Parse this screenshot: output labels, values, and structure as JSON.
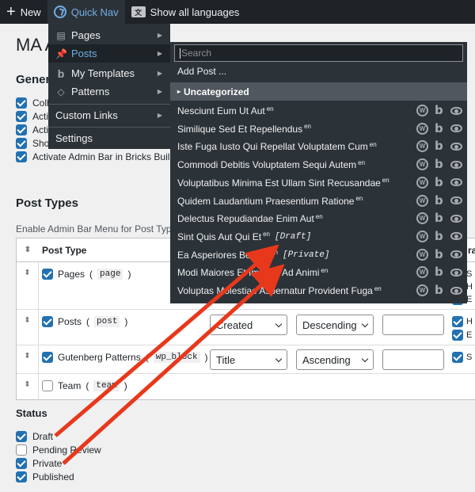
{
  "adminbar": {
    "new_label": "New",
    "quicknav_label": "Quick Nav",
    "languages_label": "Show all languages"
  },
  "quicknav_menu": {
    "items": [
      {
        "label": "Pages",
        "icon": "pages-icon"
      },
      {
        "label": "Posts",
        "icon": "pin-icon"
      },
      {
        "label": "My Templates",
        "icon": "bricks-icon"
      },
      {
        "label": "Patterns",
        "icon": "patterns-icon"
      },
      {
        "label": "Custom Links"
      },
      {
        "label": "Settings"
      }
    ]
  },
  "posts_submenu": {
    "search_placeholder": "Search",
    "add_post_label": "Add Post ...",
    "category_label": "Uncategorized",
    "posts": [
      {
        "title": "Nesciunt Eum Ut Aut",
        "lang": "en",
        "status": ""
      },
      {
        "title": "Similique Sed Et Repellendus",
        "lang": "en",
        "status": ""
      },
      {
        "title": "Iste Fuga Iusto Qui Repellat Voluptatem Cum",
        "lang": "en",
        "status": ""
      },
      {
        "title": "Commodi Debitis Voluptatem Sequi Autem",
        "lang": "en",
        "status": ""
      },
      {
        "title": "Voluptatibus Minima Est Ullam Sint Recusandae",
        "lang": "en",
        "status": ""
      },
      {
        "title": "Quidem Laudantium Praesentium Ratione",
        "lang": "en",
        "status": ""
      },
      {
        "title": "Delectus Repudiandae Enim Aut",
        "lang": "en",
        "status": ""
      },
      {
        "title": "Sint Quis Aut Qui Et",
        "lang": "en",
        "status": "[Draft]"
      },
      {
        "title": "Ea Asperiores Beatae",
        "lang": "en",
        "status": "[Private]"
      },
      {
        "title": "Modi Maiores Et Impedit Ad Animi",
        "lang": "en",
        "status": ""
      },
      {
        "title": "Voluptas Molestiae Aspernatur Provident Fuga",
        "lang": "en",
        "status": ""
      }
    ]
  },
  "page": {
    "title": "MA A",
    "general_heading": "Gener",
    "general_items": [
      {
        "label": "Coll",
        "checked": true
      },
      {
        "label": "Acti",
        "checked": true
      },
      {
        "label": "Acti",
        "checked": true
      },
      {
        "label": "Sho",
        "checked": true
      },
      {
        "label": "Activate Admin Bar in Bricks Buil",
        "checked": true
      }
    ],
    "post_types_heading": "Post Types",
    "post_types_subtext": "Enable Admin Bar Menu for Post Type",
    "table_header": "Post Type",
    "table_header_right": "ra",
    "rows": [
      {
        "label": "Pages",
        "slug": "page",
        "checked": true
      },
      {
        "label": "Posts",
        "slug": "post",
        "checked": true,
        "orderby": "Created",
        "order": "Descending",
        "mini": [
          "H",
          "E"
        ]
      },
      {
        "label": "Gutenberg Patterns",
        "slug": "wp_block",
        "checked": true,
        "orderby": "Title",
        "order": "Ascending",
        "mini": [
          "S"
        ]
      },
      {
        "label": "Team",
        "slug": "team",
        "checked": false
      }
    ],
    "pages_row_mini": [
      "S",
      "H",
      "E"
    ],
    "status_heading": "Status",
    "status_items": [
      {
        "label": "Draft",
        "checked": true
      },
      {
        "label": "Pending Review",
        "checked": false
      },
      {
        "label": "Private",
        "checked": true
      },
      {
        "label": "Published",
        "checked": true
      }
    ]
  },
  "colors": {
    "adminbar_bg": "#1d2327",
    "menu_bg": "#2c3338",
    "accent": "#72aee6",
    "checkbox": "#2271b1",
    "annotation_arrow": "#e8381c"
  }
}
